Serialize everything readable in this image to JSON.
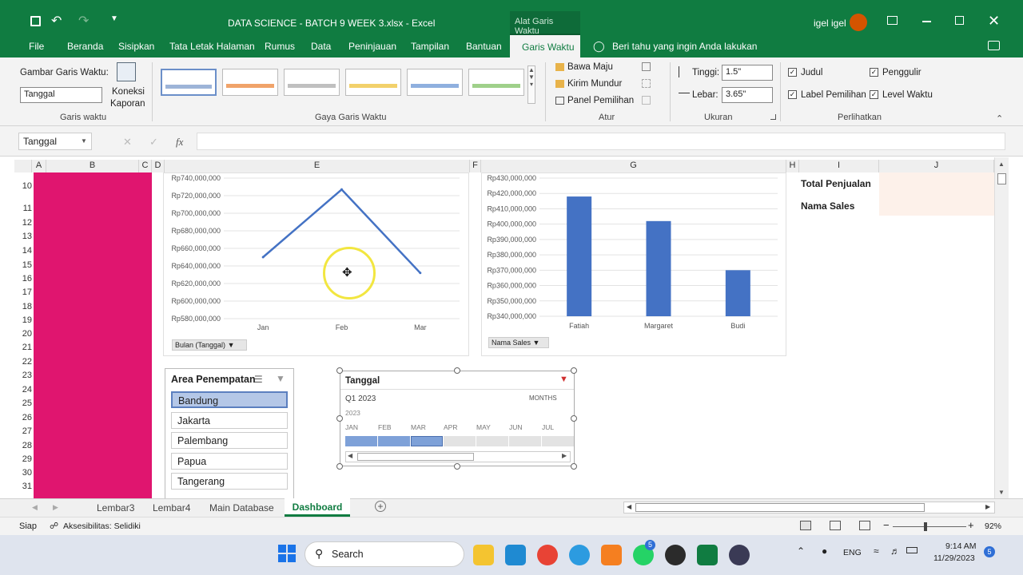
{
  "window": {
    "title": "DATA SCIENCE - BATCH 9 WEEK 3.xlsx  -  Excel",
    "context_tab_header": "Alat Garis Waktu",
    "user": "igel igel"
  },
  "menu": {
    "tabs": [
      "File",
      "Beranda",
      "Sisipkan",
      "Tata Letak Halaman",
      "Rumus",
      "Data",
      "Peninjauan",
      "Tampilan",
      "Bantuan",
      "Garis Waktu"
    ],
    "tell_me": "Beri tahu yang ingin Anda lakukan"
  },
  "ribbon": {
    "timeline_caption_label": "Gambar Garis Waktu:",
    "timeline_caption_value": "Tanggal",
    "report_connections": [
      "Koneksi",
      "Kaporan"
    ],
    "group_garis_waktu": "Garis waktu",
    "group_gaya": "Gaya Garis Waktu",
    "group_atur": "Atur",
    "group_ukuran": "Ukuran",
    "group_perlihatkan": "Perlihatkan",
    "bring_forward": "Bawa Maju",
    "send_backward": "Kirim Mundur",
    "selection_pane": "Panel Pemilihan",
    "height_label": "Tinggi:",
    "height_value": "1.5\"",
    "width_label": "Lebar:",
    "width_value": "3.65\"",
    "show_header": "Judul",
    "show_scrollbar": "Penggulir",
    "show_selection_label": "Label Pemilihan",
    "show_time_level": "Level Waktu"
  },
  "formula_bar": {
    "name_box": "Tanggal",
    "fx": "fx",
    "value": ""
  },
  "grid": {
    "columns": [
      "A",
      "B",
      "C",
      "D",
      "E",
      "F",
      "G",
      "H",
      "I",
      "J"
    ],
    "rows": [
      "10",
      "11",
      "12",
      "13",
      "14",
      "15",
      "16",
      "17",
      "18",
      "19",
      "20",
      "21",
      "22",
      "23",
      "24",
      "25",
      "26",
      "27",
      "28",
      "29",
      "30",
      "31"
    ],
    "cell_i10": "Total Penjualan",
    "cell_i11": "Nama Sales"
  },
  "chart_data": [
    {
      "type": "line",
      "categories": [
        "Jan",
        "Feb",
        "Mar"
      ],
      "values": [
        650000000,
        727000000,
        632000000
      ],
      "yticks": [
        "Rp740,000,000",
        "Rp720,000,000",
        "Rp700,000,000",
        "Rp680,000,000",
        "Rp660,000,000",
        "Rp640,000,000",
        "Rp620,000,000",
        "Rp600,000,000",
        "Rp580,000,000"
      ],
      "ylim": [
        580000000,
        740000000
      ],
      "field_button": "Bulan (Tanggal)",
      "color": "#4472c4"
    },
    {
      "type": "bar",
      "categories": [
        "Fatiah",
        "Margaret",
        "Budi"
      ],
      "values": [
        418000000,
        402000000,
        370000000
      ],
      "yticks": [
        "Rp430,000,000",
        "Rp420,000,000",
        "Rp410,000,000",
        "Rp400,000,000",
        "Rp390,000,000",
        "Rp380,000,000",
        "Rp370,000,000",
        "Rp360,000,000",
        "Rp350,000,000",
        "Rp340,000,000"
      ],
      "ylim": [
        340000000,
        430000000
      ],
      "field_button": "Nama Sales",
      "color": "#4472c4"
    }
  ],
  "slicer": {
    "title": "Area Penempatan",
    "items": [
      "Bandung",
      "Jakarta",
      "Palembang",
      "Papua",
      "Tangerang"
    ],
    "selected": "Bandung"
  },
  "timeline": {
    "title": "Tanggal",
    "period": "Q1 2023",
    "level": "MONTHS",
    "year": "2023",
    "months": [
      "JAN",
      "FEB",
      "MAR",
      "APR",
      "MAY",
      "JUN",
      "JUL"
    ]
  },
  "sheet_tabs": [
    "Lembar3",
    "Lembar4",
    "Main Database",
    "Dashboard"
  ],
  "active_sheet": "Dashboard",
  "status": {
    "ready": "Siap",
    "accessibility": "Aksesibilitas: Selidiki",
    "zoom": "92%"
  },
  "taskbar": {
    "search": "Search",
    "lang": "ENG",
    "time": "9:14 AM",
    "date": "11/29/2023",
    "whatsapp_badge": "5",
    "notif_badge": "5"
  }
}
